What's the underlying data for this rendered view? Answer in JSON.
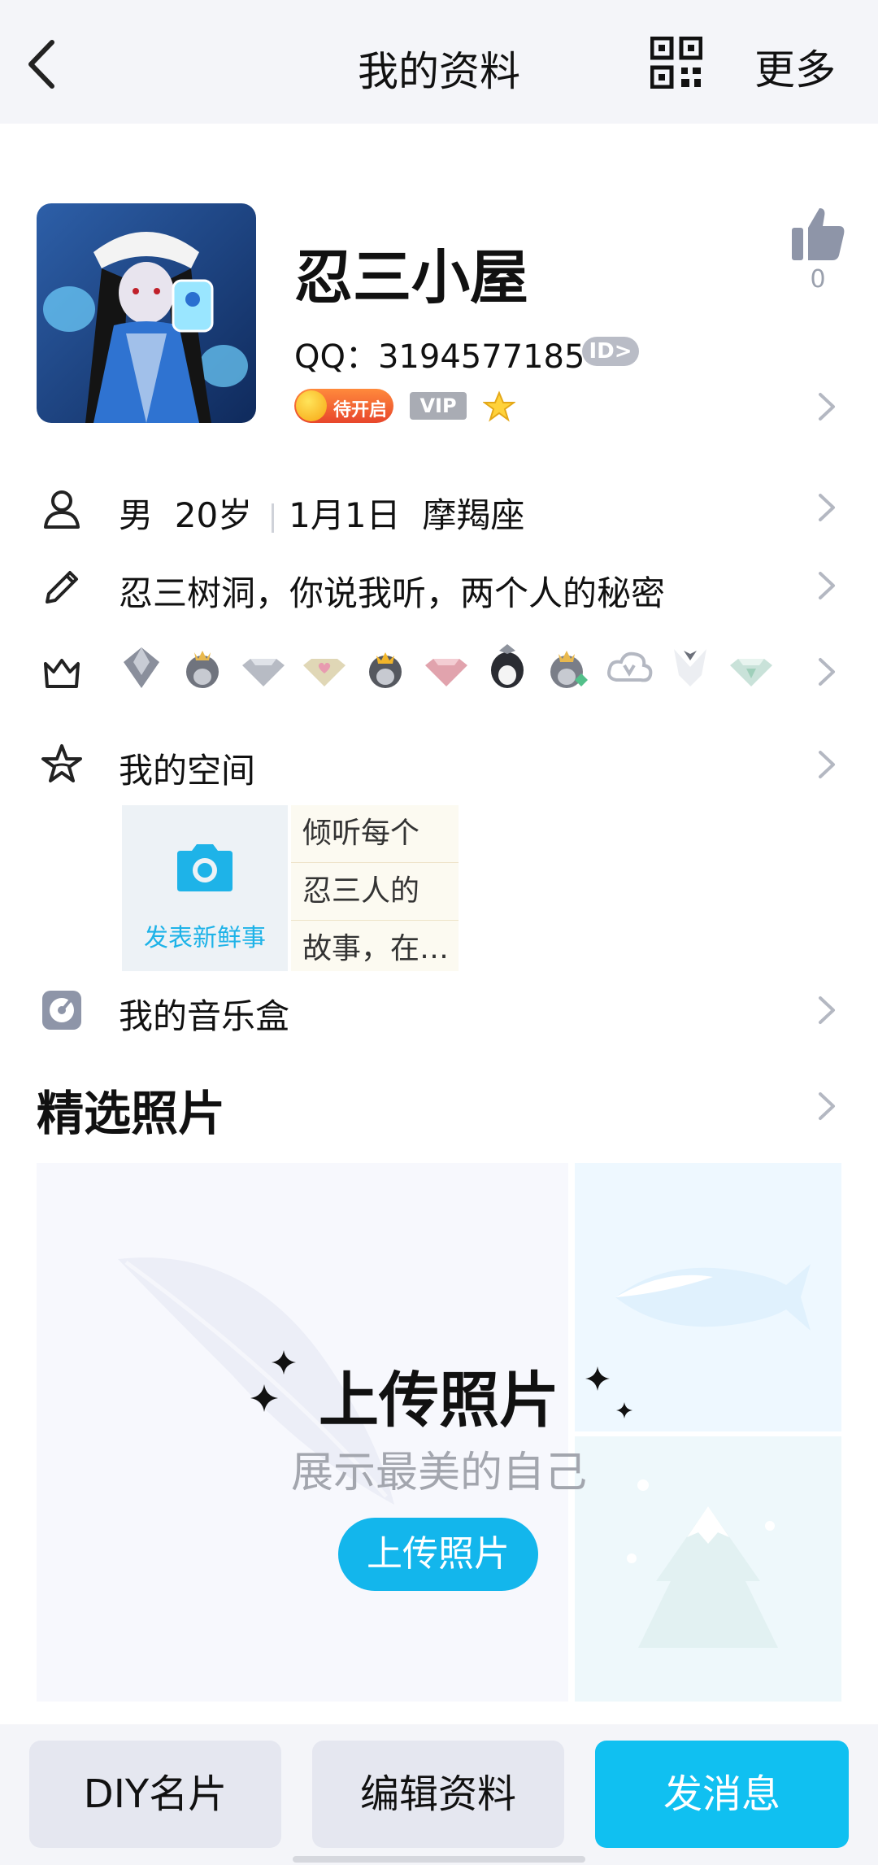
{
  "header": {
    "title": "我的资料",
    "more_label": "更多"
  },
  "profile": {
    "nickname": "忍三小屋",
    "qq_label": "QQ：3194577185",
    "id_badge": "ID>",
    "open_badge": "待开启",
    "vip_badge": "VIP",
    "like_count": "0"
  },
  "info": {
    "gender": "男",
    "age": "20岁",
    "birthday": "1月1日",
    "zodiac": "摩羯座",
    "signature": "忍三树洞，你说我听，两个人的秘密"
  },
  "medals": [
    "gem-shield-icon",
    "crown-penguin-icon",
    "silver-diamond-icon",
    "heart-diamond-icon",
    "gold-crown-penguin-icon",
    "pink-diamond-icon",
    "black-penguin-icon",
    "green-crown-penguin-icon",
    "cloud-v-icon",
    "tuxedo-icon",
    "mint-diamond-icon"
  ],
  "space": {
    "title": "我的空间",
    "post_label": "发表新鲜事",
    "preview_lines": [
      "倾听每个",
      "忍三人的",
      "故事，在…"
    ]
  },
  "music": {
    "title": "我的音乐盒"
  },
  "photos": {
    "section_title": "精选照片",
    "upload_title": "上传照片",
    "upload_subtitle": "展示最美的自己",
    "upload_button": "上传照片"
  },
  "bottom": {
    "diy_label": "DIY名片",
    "edit_label": "编辑资料",
    "message_label": "发消息"
  },
  "colors": {
    "accent": "#10c0f1",
    "badge_gray": "#a9acb4",
    "text": "#111111"
  }
}
